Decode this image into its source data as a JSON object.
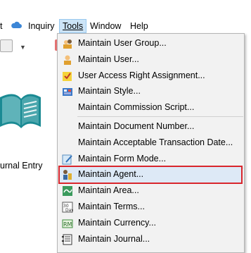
{
  "menubar": {
    "items": [
      {
        "label": "t"
      },
      {
        "label": "Inquiry"
      },
      {
        "label": "Tools"
      },
      {
        "label": "Window"
      },
      {
        "label": "Help"
      }
    ]
  },
  "left": {
    "entry_label": "urnal Entry"
  },
  "tools_menu": {
    "items": [
      {
        "label": "Maintain User Group...",
        "icon": "user-group-icon"
      },
      {
        "label": "Maintain User...",
        "icon": "user-icon"
      },
      {
        "label": "User Access Right Assignment...",
        "icon": "access-right-icon"
      },
      {
        "label": "Maintain Style...",
        "icon": "style-icon"
      },
      {
        "label": "Maintain Commission Script...",
        "icon": ""
      },
      {
        "label": "Maintain Document Number...",
        "icon": ""
      },
      {
        "label": "Maintain Acceptable Transaction Date...",
        "icon": ""
      },
      {
        "label": "Maintain Form Mode...",
        "icon": "form-mode-icon"
      },
      {
        "label": "Maintain Agent...",
        "icon": "agent-icon"
      },
      {
        "label": "Maintain Area...",
        "icon": "area-icon"
      },
      {
        "label": "Maintain Terms...",
        "icon": "terms-icon"
      },
      {
        "label": "Maintain Currency...",
        "icon": "currency-icon"
      },
      {
        "label": "Maintain Journal...",
        "icon": "journal-icon"
      }
    ]
  }
}
